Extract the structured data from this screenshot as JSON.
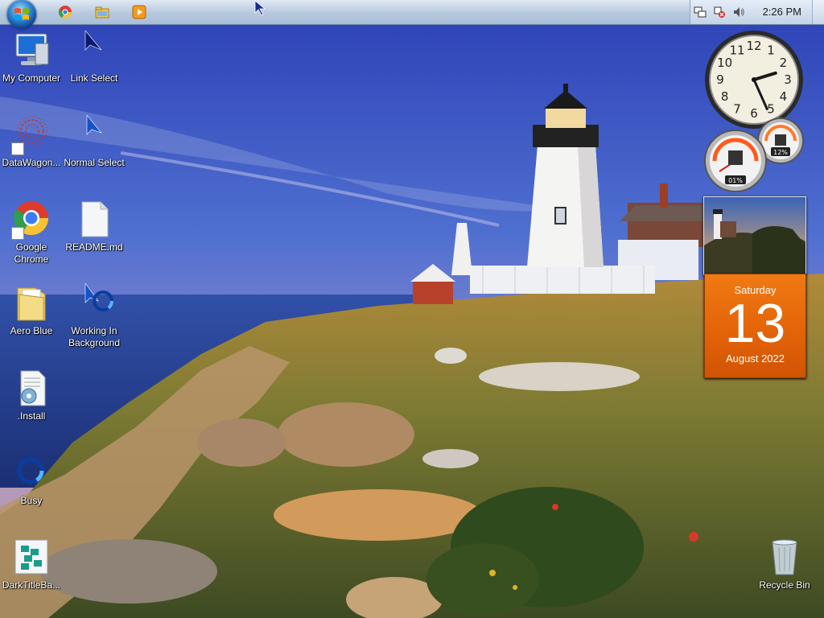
{
  "taskbar": {
    "start_label": "Start",
    "pinned": [
      {
        "name": "chrome-taskbar-icon"
      },
      {
        "name": "explorer-taskbar-icon"
      },
      {
        "name": "media-player-taskbar-icon"
      }
    ],
    "tray": {
      "time": "2:26 PM",
      "icons": [
        "network-icon",
        "flag-icon",
        "volume-icon"
      ]
    }
  },
  "desktop": {
    "icons": [
      {
        "label": "My Computer",
        "icon": "computer-icon"
      },
      {
        "label": "Link Select",
        "icon": "link-select-cursor-icon"
      },
      {
        "label": "DataWagon...",
        "icon": "datawagon-icon"
      },
      {
        "label": "Normal Select",
        "icon": "normal-select-cursor-icon"
      },
      {
        "label": "Google Chrome",
        "icon": "chrome-icon"
      },
      {
        "label": "README.md",
        "icon": "document-icon"
      },
      {
        "label": "Aero Blue",
        "icon": "folder-icon"
      },
      {
        "label": "Working In Background",
        "icon": "working-cursor-icon"
      },
      {
        "label": ".Install",
        "icon": "install-script-icon"
      },
      {
        "label": "Busy",
        "icon": "busy-cursor-icon"
      },
      {
        "label": "DarkTitleBa...",
        "icon": "package-icon"
      },
      {
        "label": "Recycle Bin",
        "icon": "recycle-bin-icon"
      }
    ]
  },
  "gadgets": {
    "clock": {
      "hour": 2,
      "minute": 26,
      "numerals": [
        "12",
        "1",
        "2",
        "3",
        "4",
        "5",
        "6",
        "7",
        "8",
        "9",
        "10",
        "11"
      ]
    },
    "cpu_meter": {
      "cpu": "01%",
      "memory": "12%"
    },
    "calendar": {
      "weekday": "Saturday",
      "day": "13",
      "month_year": "August 2022"
    }
  },
  "colors": {
    "taskbar_top": "#dfe9f4",
    "calendar_orange": "#e26208",
    "sky_blue": "#3d5bc4"
  }
}
